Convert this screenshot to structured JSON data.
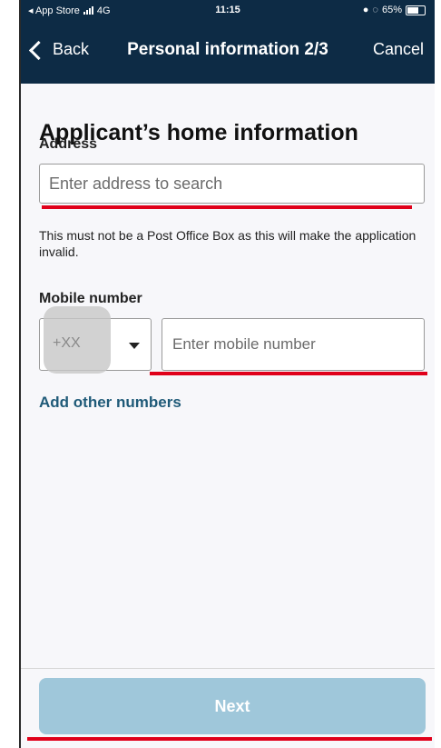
{
  "status_bar": {
    "carrier": "◂ App Store",
    "network": "4G",
    "time": "11:15",
    "battery": "65%"
  },
  "nav": {
    "back_label": "Back",
    "title": "Personal information 2/3",
    "cancel_label": "Cancel"
  },
  "form": {
    "heading": "Applicant’s home information",
    "address_label": "Address",
    "address_placeholder": "Enter address to search",
    "address_helper": "This must not be a Post Office Box as this will make the application invalid.",
    "mobile_label": "Mobile number",
    "country_code_placeholder": "+XX",
    "mobile_placeholder": "Enter mobile number",
    "add_numbers_link": "Add other numbers"
  },
  "footer": {
    "next_label": "Next"
  },
  "colors": {
    "nav_background": "#0d2b45",
    "link": "#1f5a78",
    "next_button_disabled": "#9fc7da",
    "annotation_line": "#e0001a"
  }
}
